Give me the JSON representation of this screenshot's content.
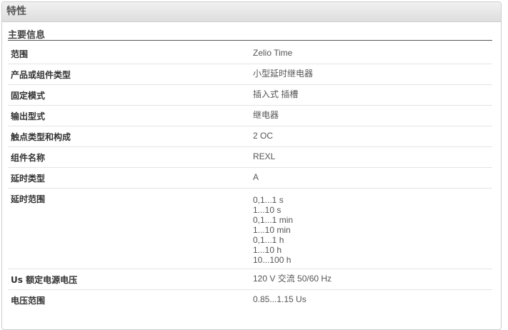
{
  "panel": {
    "title": "特性"
  },
  "section": {
    "title": "主要信息"
  },
  "rows": [
    {
      "key": "范围",
      "values": [
        "Zelio Time"
      ]
    },
    {
      "key": "产品或组件类型",
      "values": [
        "小型延时继电器"
      ]
    },
    {
      "key": "固定模式",
      "values": [
        "插入式 插槽"
      ]
    },
    {
      "key": "输出型式",
      "values": [
        "继电器"
      ]
    },
    {
      "key": "触点类型和构成",
      "values": [
        "2 OC"
      ]
    },
    {
      "key": "组件名称",
      "values": [
        "REXL"
      ]
    },
    {
      "key": "延时类型",
      "values": [
        "A"
      ]
    },
    {
      "key": "延时范围",
      "values": [
        "0,1...1 s",
        "1...10 s",
        "0,1...1 min",
        "1...10 min",
        "0,1...1 h",
        "1...10 h",
        "10...100 h"
      ]
    },
    {
      "key": "Us 额定电源电压",
      "values": [
        "120 V 交流 50/60 Hz"
      ]
    },
    {
      "key": "电压范围",
      "values": [
        "0.85...1.15 Us"
      ]
    }
  ]
}
